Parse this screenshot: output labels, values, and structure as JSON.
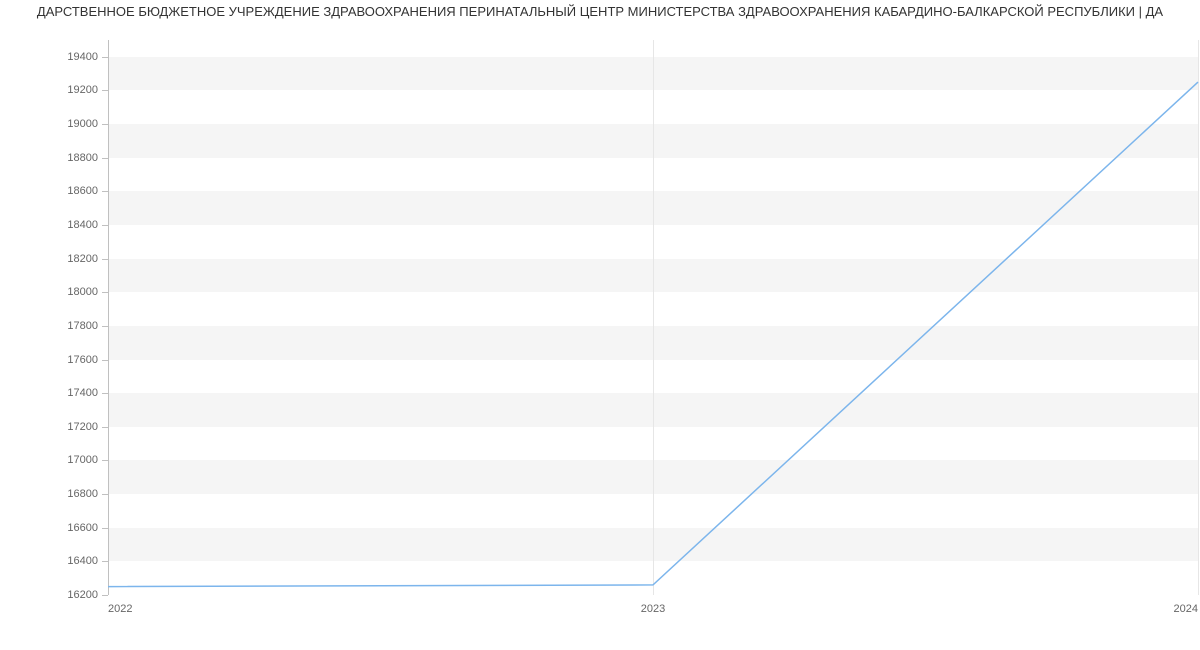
{
  "chart_data": {
    "type": "line",
    "title": "ДАРСТВЕННОЕ БЮДЖЕТНОЕ УЧРЕЖДЕНИЕ ЗДРАВООХРАНЕНИЯ ПЕРИНАТАЛЬНЫЙ ЦЕНТР МИНИСТЕРСТВА ЗДРАВООХРАНЕНИЯ КАБАРДИНО-БАЛКАРСКОЙ РЕСПУБЛИКИ | ДА",
    "x": [
      2022,
      2023,
      2024
    ],
    "values": [
      16250,
      16260,
      19250
    ],
    "x_ticks": [
      2022,
      2023,
      2024
    ],
    "x_tick_labels": [
      "2022",
      "2023",
      "2024"
    ],
    "y_ticks": [
      16200,
      16400,
      16600,
      16800,
      17000,
      17200,
      17400,
      17600,
      17800,
      18000,
      18200,
      18400,
      18600,
      18800,
      19000,
      19200,
      19400
    ],
    "y_tick_labels": [
      "16200",
      "16400",
      "16600",
      "16800",
      "17000",
      "17200",
      "17400",
      "17600",
      "17800",
      "18000",
      "18200",
      "18400",
      "18600",
      "18800",
      "19000",
      "19200",
      "19400"
    ],
    "ylim": [
      16200,
      19500
    ],
    "xlim": [
      2022,
      2024
    ],
    "line_color": "#7cb5ec",
    "band_color": "#f5f5f5"
  }
}
